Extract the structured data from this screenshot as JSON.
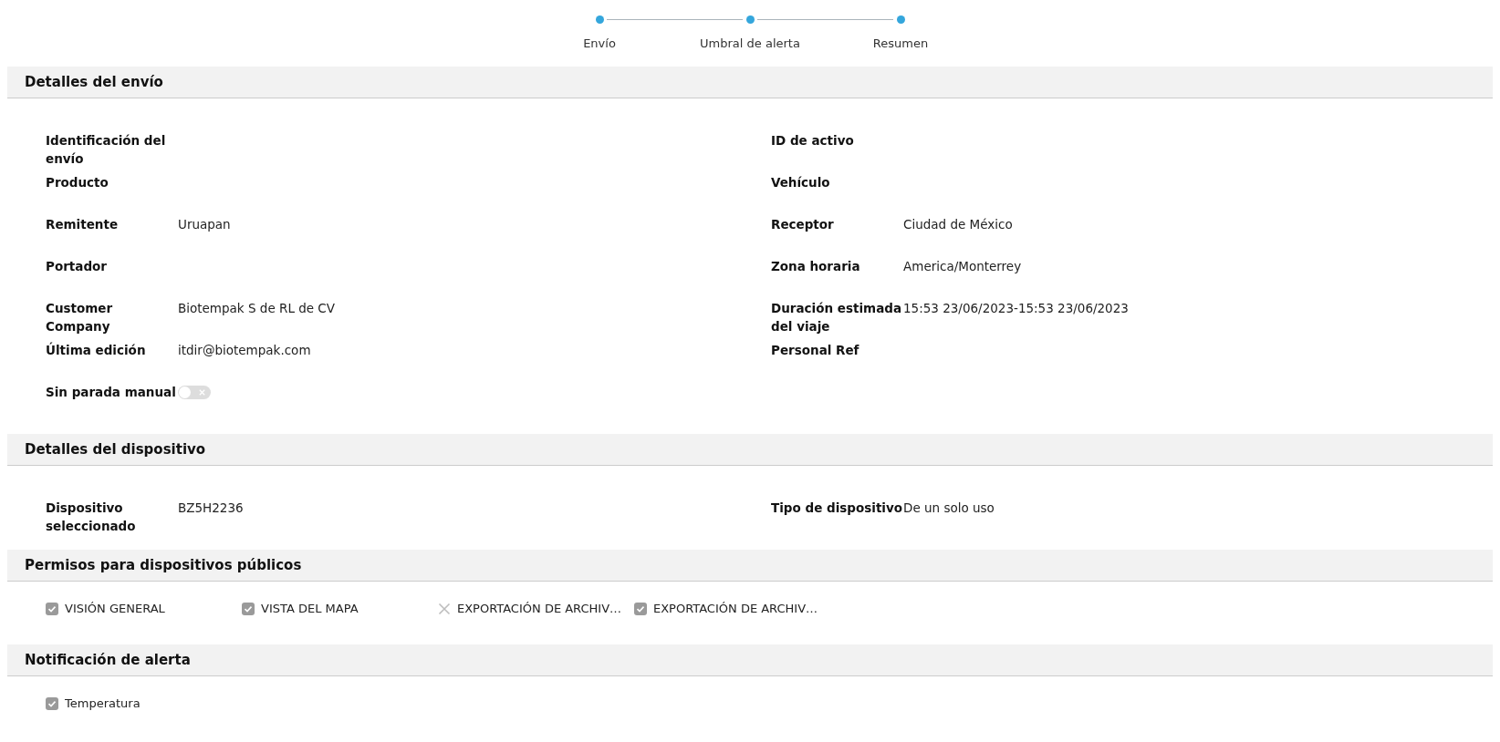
{
  "stepper": {
    "steps": [
      {
        "label": "Envío"
      },
      {
        "label": "Umbral de alerta"
      },
      {
        "label": "Resumen"
      }
    ]
  },
  "shipment_details": {
    "title": "Detalles del envío",
    "left": [
      {
        "label": "Identificación del envío"
      },
      {
        "label": "Producto"
      },
      {
        "label": "Remitente",
        "value": "Uruapan"
      },
      {
        "label": "Portador"
      },
      {
        "label": "Customer Company",
        "value": "Biotempak S de RL de CV"
      },
      {
        "label": "Última edición",
        "value": "itdir@biotempak.com"
      },
      {
        "label": "Sin parada manual",
        "kind": "toggle",
        "on": false
      }
    ],
    "right": [
      {
        "label": "ID de activo"
      },
      {
        "label": "Vehículo"
      },
      {
        "label": "Receptor",
        "value": "Ciudad de México"
      },
      {
        "label": "Zona horaria",
        "value": "America/Monterrey"
      },
      {
        "label": "Duración estimada del viaje",
        "value": "15:53 23/06/2023-15:53 23/06/2023"
      },
      {
        "label": "Personal Ref"
      }
    ]
  },
  "device_details": {
    "title": "Detalles del dispositivo",
    "left": [
      {
        "label": "Dispositivo seleccionado",
        "value": "BZ5H2236"
      }
    ],
    "right": [
      {
        "label": "Tipo de dispositivo",
        "value": "De un solo uso"
      }
    ]
  },
  "public_permissions": {
    "title": "Permisos para dispositivos públicos",
    "items": [
      {
        "label": "VISIÓN GENERAL",
        "checked": true
      },
      {
        "label": "VISTA DEL MAPA",
        "checked": true
      },
      {
        "label": "EXPORTACIÓN DE ARCHIV…",
        "checked": false
      },
      {
        "label": "EXPORTACIÓN DE ARCHIV…",
        "checked": true
      }
    ]
  },
  "alert_notification": {
    "title": "Notificación de alerta",
    "items": [
      {
        "label": "Temperatura",
        "checked": true
      }
    ]
  }
}
